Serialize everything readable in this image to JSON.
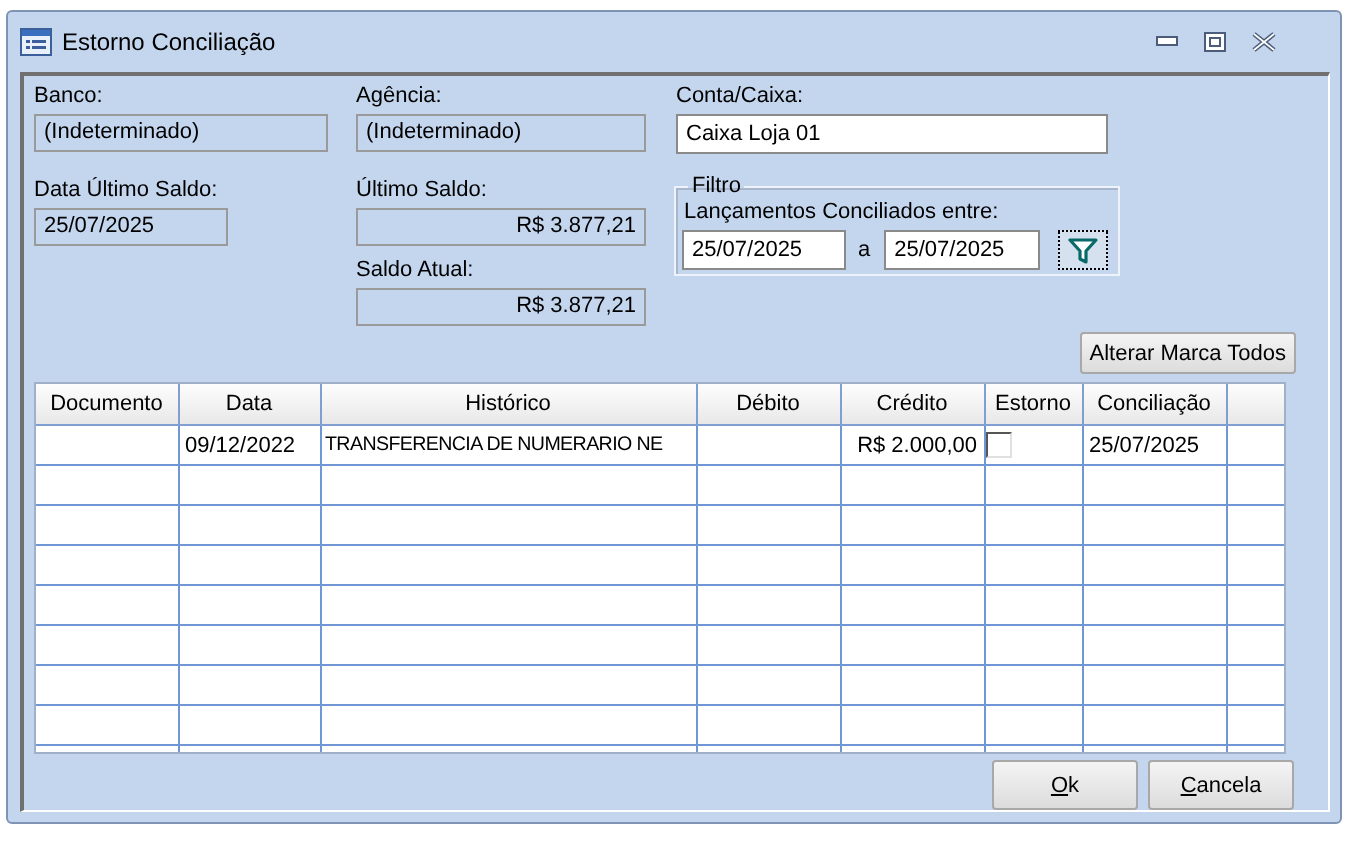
{
  "window": {
    "title": "Estorno Conciliação"
  },
  "banco": {
    "label": "Banco:",
    "value": "(Indeterminado)"
  },
  "agencia": {
    "label": "Agência:",
    "value": "(Indeterminado)"
  },
  "conta_caixa": {
    "label": "Conta/Caixa:",
    "value": "Caixa Loja 01"
  },
  "data_ultimo_saldo": {
    "label": "Data Último Saldo:",
    "value": "25/07/2025"
  },
  "ultimo_saldo": {
    "label": "Último Saldo:",
    "value": "R$ 3.877,21"
  },
  "saldo_atual": {
    "label": "Saldo Atual:",
    "value": "R$ 3.877,21"
  },
  "filtro": {
    "title": "Filtro",
    "label": "Lançamentos Conciliados entre:",
    "from": "25/07/2025",
    "separator": "a",
    "to": "25/07/2025"
  },
  "alterar_button": "Alterar Marca Todos",
  "table": {
    "columns": [
      "Documento",
      "Data",
      "Histórico",
      "Débito",
      "Crédito",
      "Estorno",
      "Conciliação"
    ],
    "rows": [
      {
        "data": "09/12/2022",
        "historico": "TRANSFERENCIA DE NUMERARIO NE",
        "credito": "R$ 2.000,00",
        "estorno": false,
        "conciliacao": "25/07/2025"
      }
    ]
  },
  "buttons": [
    {
      "label": "Ok"
    },
    {
      "label": "Cancela"
    }
  ]
}
